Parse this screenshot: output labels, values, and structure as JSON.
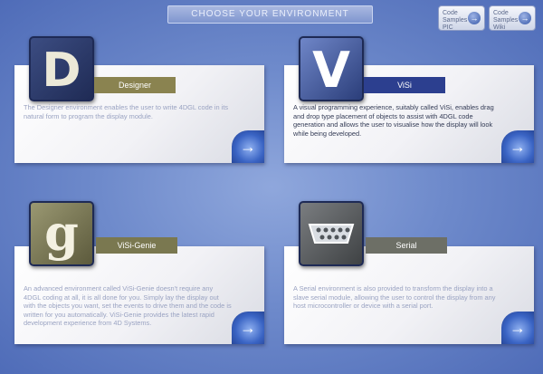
{
  "header": {
    "title": "CHOOSE YOUR ENVIRONMENT",
    "corner_buttons": [
      {
        "label": "Code Samples PIC",
        "arrow": "→"
      },
      {
        "label": "Code Samples Wiki",
        "arrow": "→"
      }
    ]
  },
  "panels": [
    {
      "name": "Designer",
      "glyph": "D",
      "description": "The Designer environment enables the user to write 4DGL code in its natural form to program the display module.",
      "arrow": "→"
    },
    {
      "name": "ViSi",
      "glyph": "V",
      "description": "A visual programming experience, suitably called ViSi, enables drag and drop type placement of objects to assist with 4DGL code generation and allows the user to visualise how the display will look while being developed.",
      "arrow": "→"
    },
    {
      "name": "ViSi-Genie",
      "glyph": "g",
      "description": "An advanced environment called ViSi-Genie doesn't require any 4DGL coding at all, it is all done for you. Simply lay the display out with the objects you want, set the events to drive them and the code is written for you automatically. ViSi-Genie provides the latest rapid development experience from 4D Systems.",
      "arrow": "→"
    },
    {
      "name": "Serial",
      "glyph": "",
      "description": "A Serial environment is also provided to transform the display into a slave serial module, allowing the user to control the display from any host microcontroller or device with a serial port.",
      "arrow": "→"
    }
  ],
  "colors": {
    "designer_tile": "#2f3f6f",
    "designer_label": "#8a8350",
    "visi_tile": "#4a5f9c",
    "visi_label": "#2c3f8f",
    "genie_tile": "#7d7b58",
    "genie_label": "#7a7850",
    "serial_tile": "#5d6062",
    "serial_label": "#6d6f66"
  }
}
